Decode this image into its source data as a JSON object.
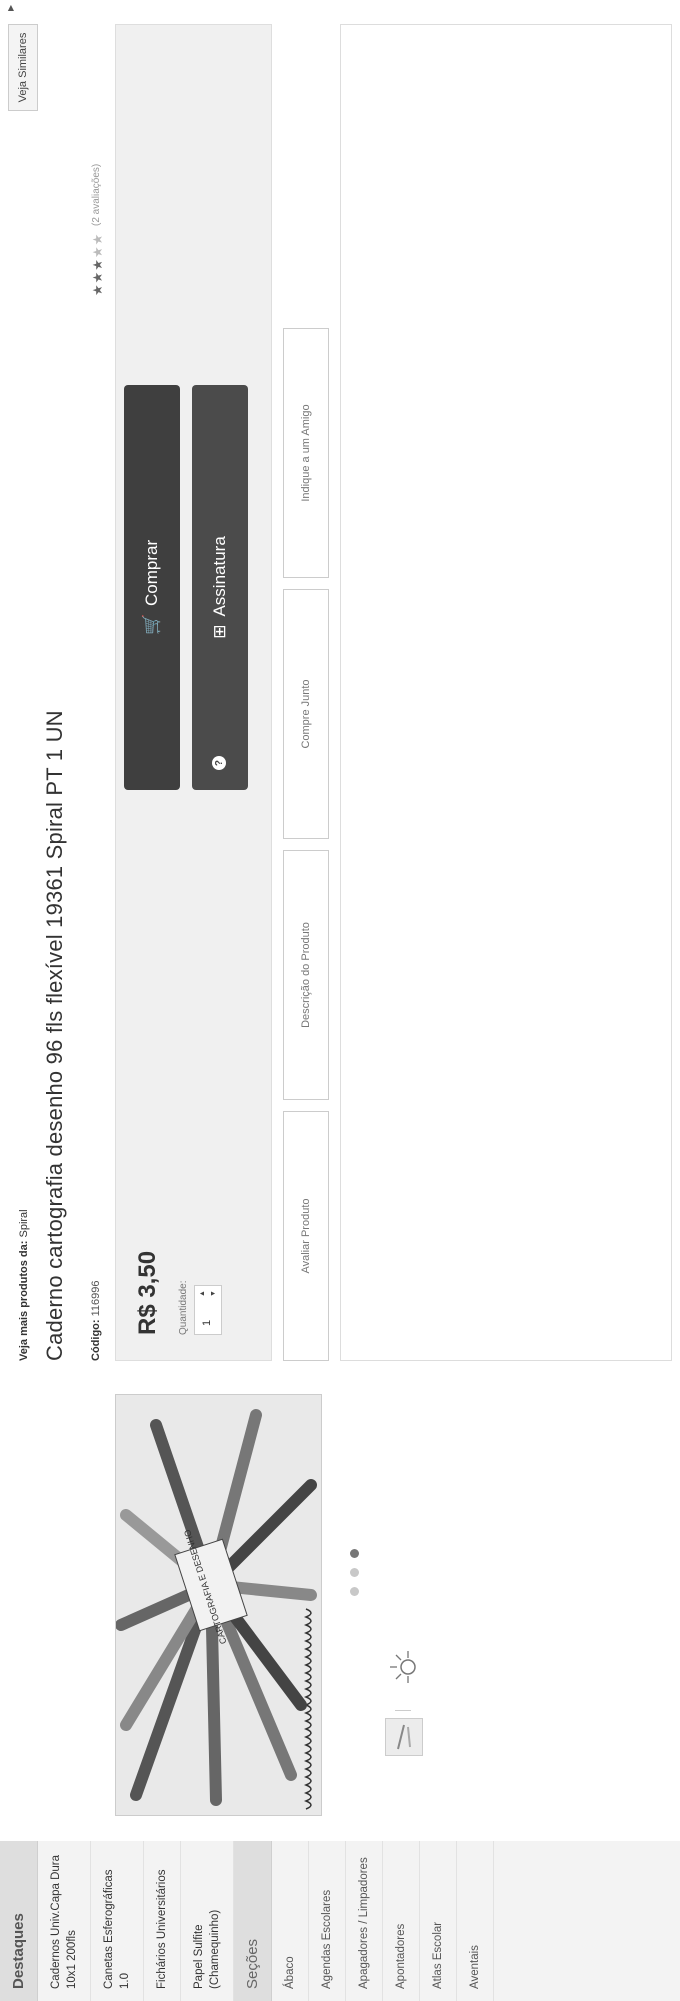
{
  "sidebar": {
    "destaques_title": "Destaques",
    "destaques": [
      "Cadernos Univ.Capa Dura 10x1 200fls",
      "Canetas Esferográficas 1.0",
      "Fichários Universitários",
      "Papel Sulfite (Chamequinho)"
    ],
    "secoes_title": "Seções",
    "secoes": [
      "Ábaco",
      "Agendas Escolares",
      "Apagadores / Limpadores",
      "Apontadores",
      "Atlas Escolar",
      "Aventais"
    ]
  },
  "product": {
    "brand_prefix": "Veja mais produtos da:",
    "brand": "Spiral",
    "title": "Caderno cartografia desenho 96 fls flexível 19361 Spiral PT 1 UN",
    "code_label": "Código:",
    "code": "116996",
    "reviews": "(2 avaliações)",
    "rating": 3,
    "rating_max": 5,
    "similar_button": "Veja Similares",
    "price": "R$ 3,50",
    "quantity_label": "Quantidade:",
    "quantity": "1",
    "buy_button": "Comprar",
    "subscription_button": "Assinatura",
    "cover_text": "CARTOGRAFIA E DESENHO"
  },
  "tabs": [
    "Avaliar Produto",
    "Descrição do Produto",
    "Compre Junto",
    "Indique a um Amigo"
  ],
  "colors": {
    "button_dark": "#3f3f3f",
    "button_sub": "#4b4b4b",
    "box_bg": "#f0f0f0"
  },
  "icons": [
    "cart-icon",
    "plus-box-icon",
    "help-icon",
    "star-icon",
    "spiral-binding-icon",
    "sun-logo-icon"
  ]
}
